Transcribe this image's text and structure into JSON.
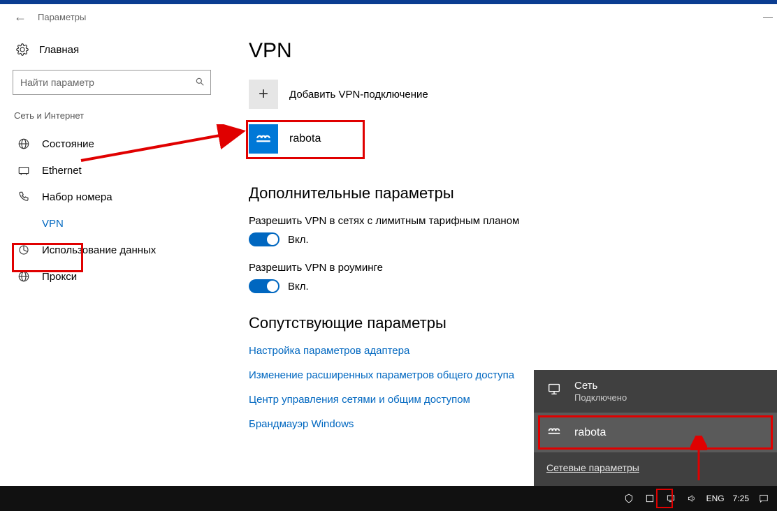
{
  "window": {
    "title": "Параметры",
    "minimize": "—"
  },
  "sidebar": {
    "home": "Главная",
    "search_placeholder": "Найти параметр",
    "section": "Сеть и Интернет",
    "items": [
      {
        "label": "Состояние"
      },
      {
        "label": "Ethernet"
      },
      {
        "label": "Набор номера"
      },
      {
        "label": "VPN"
      },
      {
        "label": "Использование данных"
      },
      {
        "label": "Прокси"
      }
    ]
  },
  "main": {
    "heading": "VPN",
    "add_label": "Добавить VPN-подключение",
    "connections": [
      {
        "name": "rabota"
      }
    ],
    "advanced_heading": "Дополнительные параметры",
    "opt1_label": "Разрешить VPN в сетях с лимитным тарифным планом",
    "opt1_state": "Вкл.",
    "opt2_label": "Разрешить VPN в роуминге",
    "opt2_state": "Вкл.",
    "related_heading": "Сопутствующие параметры",
    "links": [
      "Настройка параметров адаптера",
      "Изменение расширенных параметров общего доступа",
      "Центр управления сетями и общим доступом",
      "Брандмауэр Windows"
    ]
  },
  "flyout": {
    "network_name": "Сеть",
    "network_status": "Подключено",
    "vpn_name": "rabota",
    "settings_link": "Сетевые параметры"
  },
  "taskbar": {
    "lang": "ENG",
    "time": "7:25"
  }
}
